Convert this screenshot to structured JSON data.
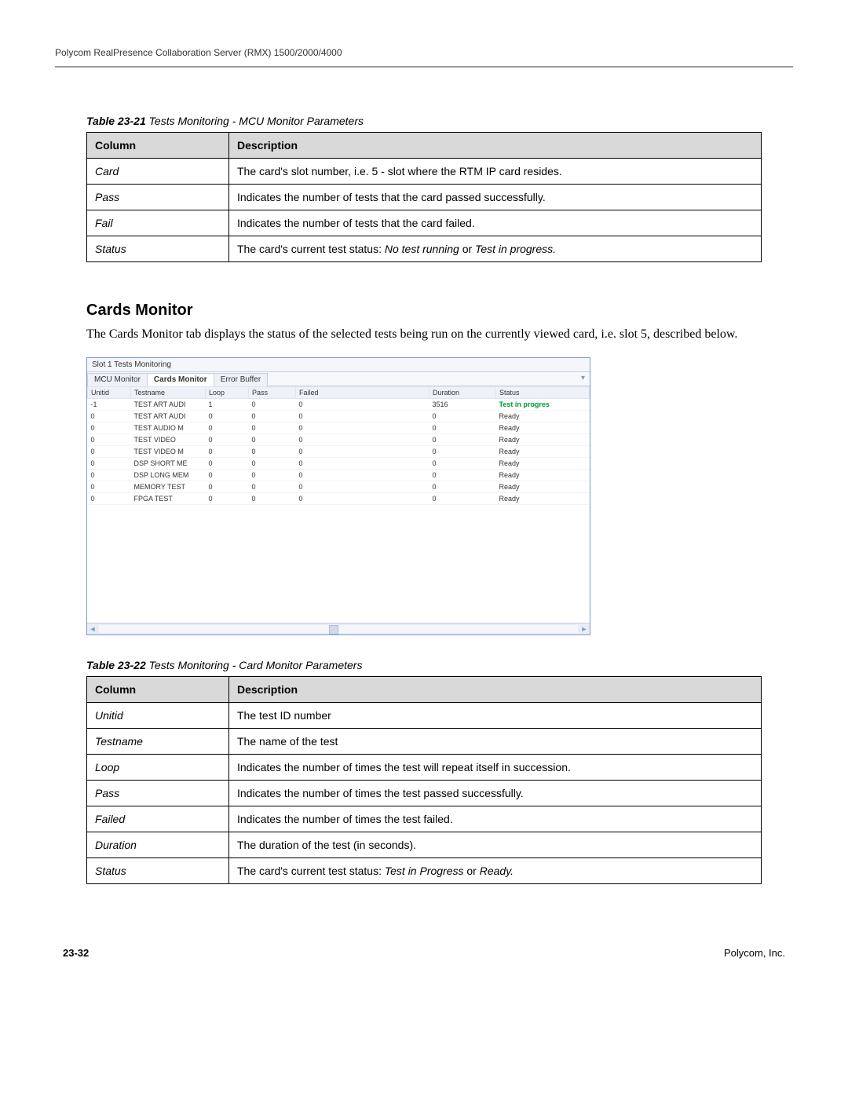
{
  "header": {
    "title": "Polycom RealPresence Collaboration Server (RMX) 1500/2000/4000"
  },
  "table21": {
    "caption_prefix": "Table 23-21",
    "caption_rest": " Tests Monitoring - MCU Monitor Parameters",
    "head_col": "Column",
    "head_desc": "Description",
    "rows": [
      {
        "col": "Card",
        "desc": "The card's slot number, i.e. 5 - slot where the RTM IP card resides."
      },
      {
        "col": "Pass",
        "desc": "Indicates the number of tests that the card passed successfully."
      },
      {
        "col": "Fail",
        "desc": "Indicates the number of tests that the card failed."
      },
      {
        "col": "Status",
        "desc_pre": "The card's current test status: ",
        "desc_it1": "No test running",
        "desc_mid": " or ",
        "desc_it2": "Test in progress."
      }
    ]
  },
  "section": {
    "heading": "Cards Monitor",
    "body": "The Cards Monitor tab displays the status of the selected tests being run on the currently viewed card, i.e. slot 5, described below."
  },
  "screenshot": {
    "title": "Slot 1 Tests Monitoring",
    "tabs": [
      "MCU Monitor",
      "Cards Monitor",
      "Error Buffer"
    ],
    "active_tab": 1,
    "pin": "▾",
    "columns": [
      "Unitid",
      "Testname",
      "Loop",
      "Pass",
      "Failed",
      "Duration",
      "Status"
    ],
    "rows": [
      {
        "u": "-1",
        "t": "TEST ART AUDI",
        "l": "1",
        "p": "0",
        "f": "0",
        "d": "3516",
        "s": "Test in progres",
        "green": true
      },
      {
        "u": "0",
        "t": "TEST ART AUDI",
        "l": "0",
        "p": "0",
        "f": "0",
        "d": "0",
        "s": "Ready"
      },
      {
        "u": "0",
        "t": "TEST AUDIO M",
        "l": "0",
        "p": "0",
        "f": "0",
        "d": "0",
        "s": "Ready"
      },
      {
        "u": "0",
        "t": "TEST VIDEO",
        "l": "0",
        "p": "0",
        "f": "0",
        "d": "0",
        "s": "Ready"
      },
      {
        "u": "0",
        "t": "TEST VIDEO M",
        "l": "0",
        "p": "0",
        "f": "0",
        "d": "0",
        "s": "Ready"
      },
      {
        "u": "0",
        "t": "DSP SHORT ME",
        "l": "0",
        "p": "0",
        "f": "0",
        "d": "0",
        "s": "Ready"
      },
      {
        "u": "0",
        "t": "DSP LONG MEM",
        "l": "0",
        "p": "0",
        "f": "0",
        "d": "0",
        "s": "Ready"
      },
      {
        "u": "0",
        "t": "MEMORY TEST",
        "l": "0",
        "p": "0",
        "f": "0",
        "d": "0",
        "s": "Ready"
      },
      {
        "u": "0",
        "t": "FPGA TEST",
        "l": "0",
        "p": "0",
        "f": "0",
        "d": "0",
        "s": "Ready"
      }
    ]
  },
  "table22": {
    "caption_prefix": "Table 23-22",
    "caption_rest": " Tests Monitoring - Card Monitor Parameters",
    "head_col": "Column",
    "head_desc": "Description",
    "rows": [
      {
        "col": "Unitid",
        "desc": "The test ID number"
      },
      {
        "col": "Testname",
        "desc": "The name of the test"
      },
      {
        "col": "Loop",
        "desc": "Indicates the number of times the test will repeat itself in succession."
      },
      {
        "col": "Pass",
        "desc": "Indicates the number of times the test passed successfully."
      },
      {
        "col": "Failed",
        "desc": "Indicates the number of times the test failed."
      },
      {
        "col": "Duration",
        "desc": "The duration of the test (in seconds)."
      },
      {
        "col": "Status",
        "desc_pre": "The card's current test status: ",
        "desc_it1": "Test in Progress",
        "desc_mid": " or ",
        "desc_it2": "Ready."
      }
    ]
  },
  "footer": {
    "page": "23-32",
    "company": "Polycom, Inc."
  }
}
